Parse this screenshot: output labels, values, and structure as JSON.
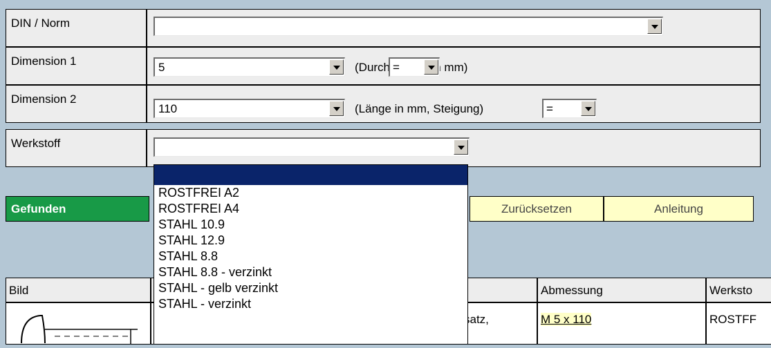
{
  "form": {
    "din_label": "DIN / Norm",
    "din_value": "",
    "dim1_label": "Dimension 1",
    "dim1_value": "5",
    "dim1_hint": "(Durchmesser in mm)",
    "dim1_op": "=",
    "dim2_label": "Dimension 2",
    "dim2_value": "110",
    "dim2_hint": "(Länge in mm, Steigung)",
    "dim2_op": "=",
    "werkstoff_label": "Werkstoff",
    "werkstoff_value": ""
  },
  "buttons": {
    "found": "Gefunden",
    "reset": "Zurücksetzen",
    "help": "Anleitung"
  },
  "results": {
    "col_bild": "Bild",
    "col_abmessung": "Abmessung",
    "col_werkstoff": "Werksto",
    "row1_desc_partial": "satz,",
    "row1_abmessung": "M 5 x 110",
    "row1_werkstoff": "ROSTFF"
  },
  "werkstoff_options": [
    "",
    "ROSTFREI A2",
    "ROSTFREI A4",
    "STAHL 10.9",
    "STAHL 12.9",
    "STAHL 8.8",
    "STAHL 8.8 - verzinkt",
    "STAHL - gelb verzinkt",
    "STAHL - verzinkt"
  ],
  "colors": {
    "background": "#b4c7d5",
    "found_button": "#189a47",
    "yellow_button": "#ffffc8",
    "selected_option": "#0a246a"
  }
}
